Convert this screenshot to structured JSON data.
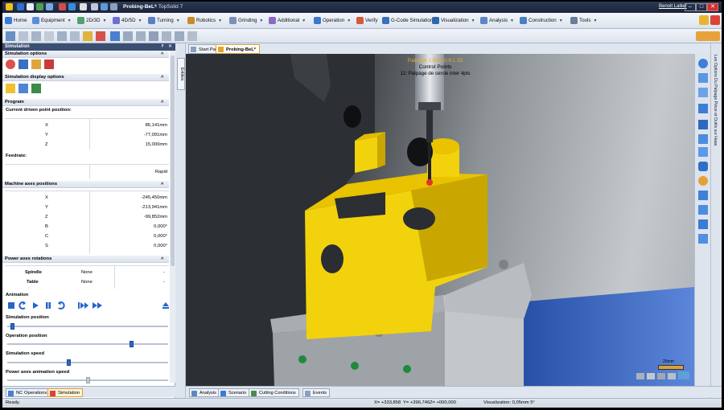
{
  "window": {
    "document_title": "Probing-BeL*",
    "app_name": "- TopSolid 7",
    "user": "Benoit Lallier",
    "controls": {
      "minimize": "–",
      "maximize": "□",
      "close": "✕"
    }
  },
  "menu_tabs": [
    {
      "label": "Home",
      "color": "#3a7bd5"
    },
    {
      "label": "Equipment",
      "color": "#5a8fd8"
    },
    {
      "label": "2D/3D",
      "color": "#4fa36a"
    },
    {
      "label": "4D/5D",
      "color": "#6d6fd1"
    },
    {
      "label": "Turning",
      "color": "#5c7fbf"
    },
    {
      "label": "Robotics",
      "color": "#c98a2b"
    },
    {
      "label": "Grinding",
      "color": "#7a90b8"
    },
    {
      "label": "Additional",
      "color": "#8a6ac2"
    },
    {
      "label": "Operation",
      "color": "#3f78c9"
    },
    {
      "label": "Verify",
      "color": "#d45b3a"
    },
    {
      "label": "G-Code Simulation",
      "color": "#3b6fb8"
    },
    {
      "label": "Visualization",
      "color": "#2e65ad"
    },
    {
      "label": "Analysis",
      "color": "#5d86c4"
    },
    {
      "label": "Construction",
      "color": "#4a7fc1"
    },
    {
      "label": "Tools",
      "color": "#6b7c96"
    }
  ],
  "panel": {
    "title": "Simulation",
    "header_controls": {
      "pin": "ᵖ",
      "close": "✕"
    },
    "sections": {
      "simulation_options": "Simulation options",
      "display_options": "Simulation display options",
      "program": "Program",
      "current_position": "Current driven point position:",
      "feedrate": "Feedrate:",
      "machine_axes": "Machine axes positions",
      "power_axes": "Power axes rotations",
      "animation": "Animation",
      "simulation_position": "Simulation position",
      "operation_position": "Operation position",
      "simulation_speed": "Simulation speed",
      "power_axes_speed": "Power axes animation speed"
    },
    "driven_point": [
      {
        "axis": "X",
        "value": "86,141mm"
      },
      {
        "axis": "Y",
        "value": "-77,091mm"
      },
      {
        "axis": "Z",
        "value": "15,000mm"
      }
    ],
    "feedrate_value": "Rapid",
    "machine_axes": [
      {
        "axis": "X",
        "value": "-245,450mm"
      },
      {
        "axis": "Y",
        "value": "-213,941mm"
      },
      {
        "axis": "Z",
        "value": "-99,852mm"
      },
      {
        "axis": "B",
        "value": "0,000°"
      },
      {
        "axis": "C",
        "value": "0,000°"
      },
      {
        "axis": "S",
        "value": "0,000°"
      }
    ],
    "power_axes": [
      {
        "label": "Spindle",
        "value": "None"
      },
      {
        "label": "Table",
        "value": "None"
      }
    ],
    "sliders": {
      "simulation_position": 0.02,
      "operation_position": 0.78,
      "simulation_speed": 0.38,
      "power_axes_speed": 0.5
    },
    "bottom_tabs": [
      "NC Operations",
      "Simulation"
    ],
    "tree_strip_label": "Entities"
  },
  "document_tabs": [
    "Start Page",
    "Probing-BeL*"
  ],
  "viewport": {
    "overlay_title": "Palpage 2 Bille 0,6 L 25",
    "overlay_subtitle": "Control Points",
    "overlay_operation": "12: Palpage de cercle inter 4pts",
    "scale_label": "20mm"
  },
  "right_panel_label": "Les Options Du Palpage Pièce et Outils sur Haas",
  "lower_tabs": [
    "Analysis",
    "Scenario",
    "Cutting Conditions",
    "Events"
  ],
  "status": {
    "text": "Ready.",
    "x": "X= +333,858",
    "y": "Y= +396,746",
    "z": "Z= +000,000",
    "visualization": "Visualization: 0,05mm 5°"
  }
}
